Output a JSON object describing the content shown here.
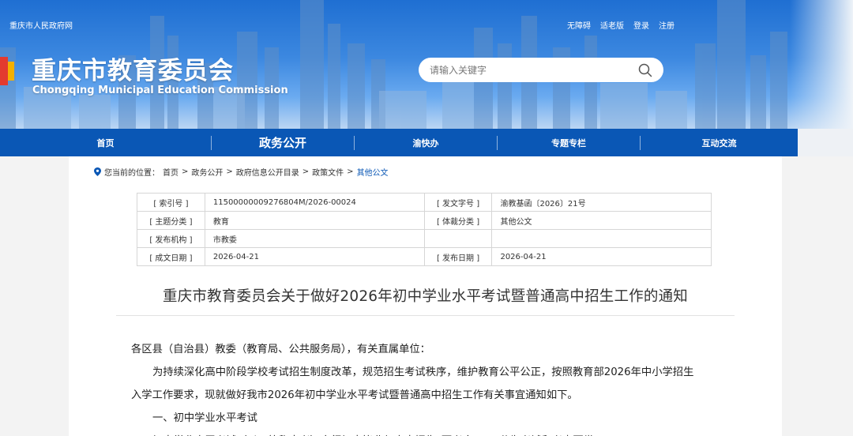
{
  "header": {
    "gov_link": "重庆市人民政府网",
    "top_links": [
      "无障碍",
      "适老版",
      "登录",
      "注册"
    ],
    "title": "重庆市教育委员会",
    "subtitle": "Chongqing Municipal Education Commission",
    "search_placeholder": "请输入关键字",
    "icons": {
      "search": "search-icon",
      "logo": "logo-mark"
    }
  },
  "nav": {
    "items": [
      "首页",
      "政务公开",
      "渝快办",
      "专题专栏",
      "互动交流"
    ],
    "active_index": 1
  },
  "breadcrumb": {
    "label": "您当前的位置：",
    "items": [
      "首页",
      "政务公开",
      "政府信息公开目录",
      "政策文件",
      "其他公文"
    ],
    "separator": ">"
  },
  "meta": {
    "rows": [
      [
        "[ 索引号 ]",
        "11500000009276804M/2026-00024",
        "[ 发文字号 ]",
        "渝教基函〔2026〕21号"
      ],
      [
        "[ 主题分类 ]",
        "教育",
        "[ 体裁分类 ]",
        "其他公文"
      ],
      [
        "[ 发布机构 ]",
        "市教委",
        "",
        ""
      ],
      [
        "[ 成文日期 ]",
        "2026-04-21",
        "[ 发布日期 ]",
        "2026-04-21"
      ]
    ]
  },
  "document": {
    "title": "重庆市教育委员会关于做好2026年初中学业水平考试暨普通高中招生工作的通知",
    "salutation": "各区县（自治县）教委（教育局、公共服务局），有关直属单位：",
    "para1_line1": "为持续深化高中阶段学校考试招生制度改革，规范招生考试秩序，维护教育公平公正，按照教育部2026年中小学招生",
    "para1_line2": "入学工作要求，现就做好我市2026年初中学业水平考试暨普通高中招生工作有关事宜通知如下。",
    "section1": "一、初中学业水平考试",
    "para2": "初中学业水平考试（以下简称中考）实行初中毕业与高中招生“两考合一”，分为考试和考查两类。"
  },
  "colors": {
    "nav_bg": "#0a57b5",
    "link": "#0a57b5"
  }
}
